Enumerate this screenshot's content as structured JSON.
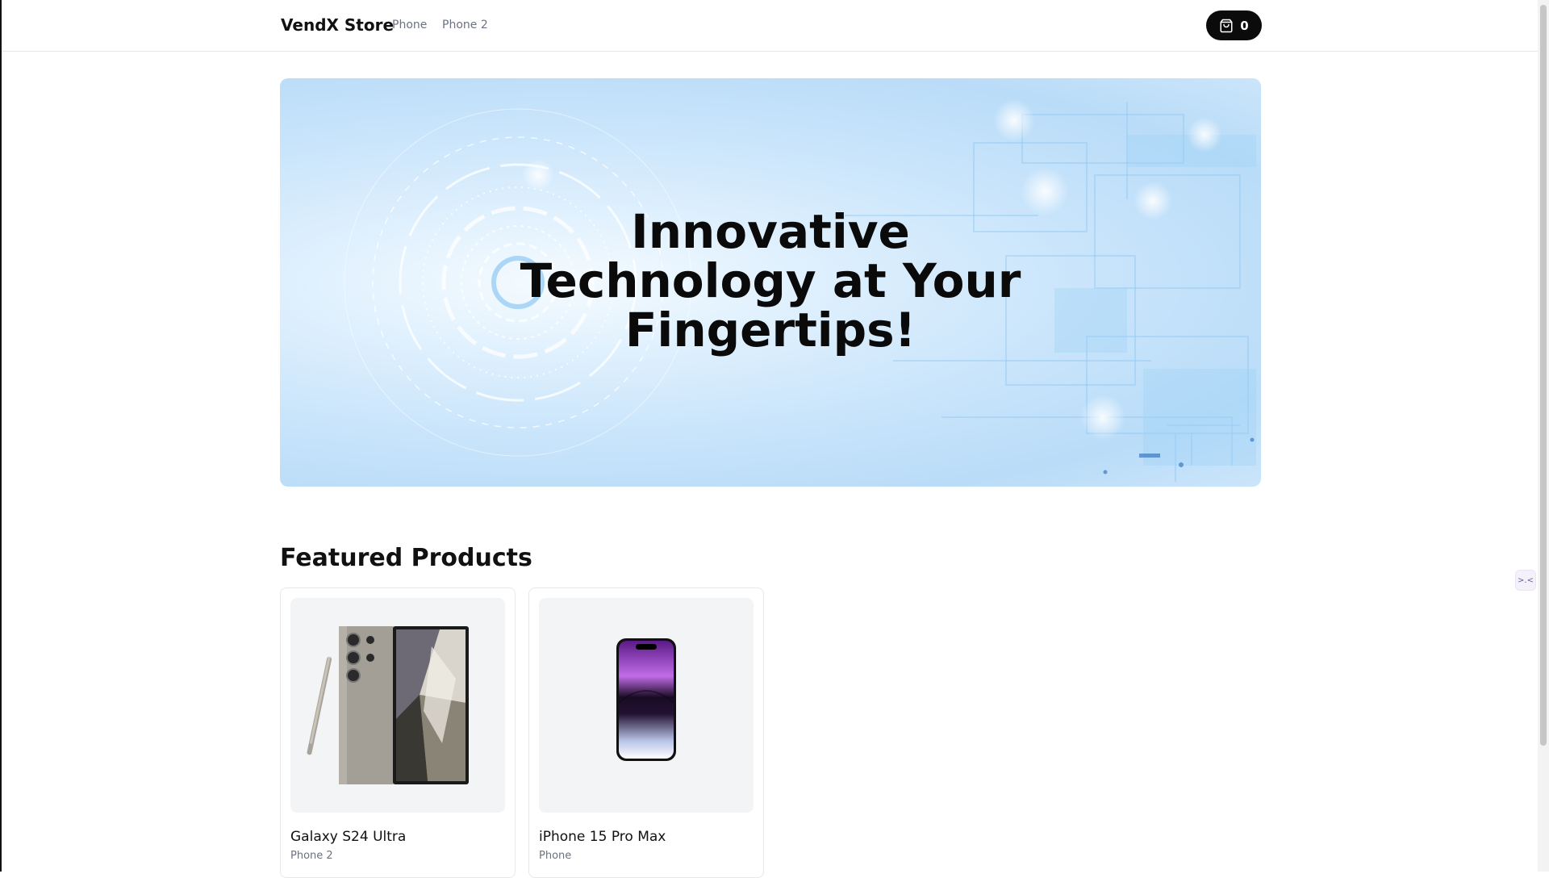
{
  "header": {
    "brand": "VendX Store",
    "nav": [
      {
        "label": "Phone"
      },
      {
        "label": "Phone 2"
      }
    ],
    "cart": {
      "icon": "shopping-bag-icon",
      "count": "0"
    }
  },
  "hero": {
    "title_lines": [
      "Innovative",
      "Technology at Your",
      "Fingertips!"
    ]
  },
  "featured": {
    "title": "Featured Products",
    "products": [
      {
        "name": "Galaxy S24 Ultra",
        "category": "Phone 2"
      },
      {
        "name": "iPhone 15 Pro Max",
        "category": "Phone"
      }
    ]
  },
  "widget": {
    "glyph": ">.<"
  },
  "colors": {
    "cart_button": "#0b0b0b",
    "hero_blue": "#c8e4fb",
    "muted_text": "#6b7280",
    "card_image_bg": "#f3f4f6"
  }
}
